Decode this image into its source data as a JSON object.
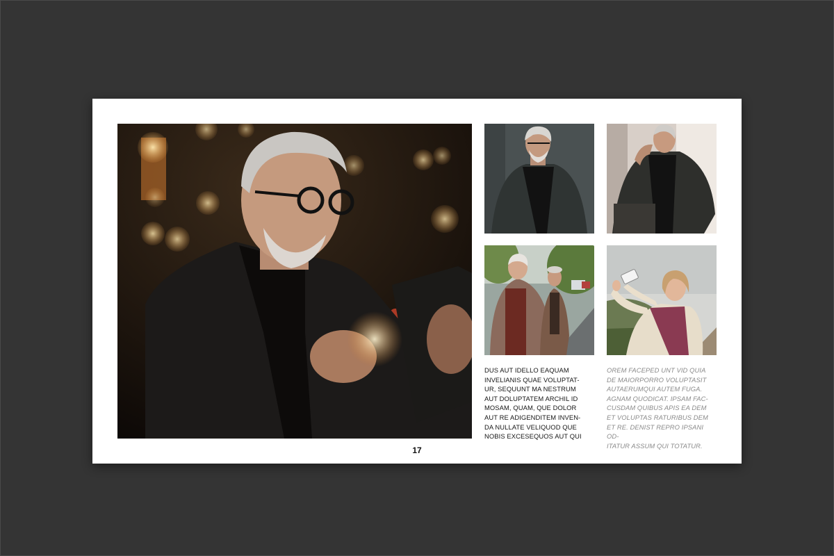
{
  "spread": {
    "page_number": "17",
    "columns": {
      "left_text": "DUS AUT IDELLO EAQUAM\nINVELIANIS QUAE VOLUPTAT-\nUR, SEQUUNT MA NESTRUM\nAUT DOLUPTATEM ARCHIL ID\nMOSAM, QUAM, QUE DOLOR\nAUT RE ADIGENDITEM INVEN-\nDA NULLATE VELIQUOD QUE\nNOBIS EXCESEQUOS AUT QUI",
      "right_text": "OREM FACEPED UNT VID QUIA\nDE MAIORPORRO VOLUPTASIT\nAUTAERUMQUI AUTEM FUGA.\nAGNAM QUODICAT. IPSAM FAC-\nCUSDAM QUIBUS APIS EA DEM\nET VOLUPTAS RATURIBUS DEM\nET RE. DENIST REPRO IPSANI OD-\nITATUR ASSUM QUI TOTATUR."
    }
  },
  "colors": {
    "background": "#343434",
    "page": "#ffffff",
    "body_text": "#161616",
    "muted_text": "#8a8a8a"
  }
}
